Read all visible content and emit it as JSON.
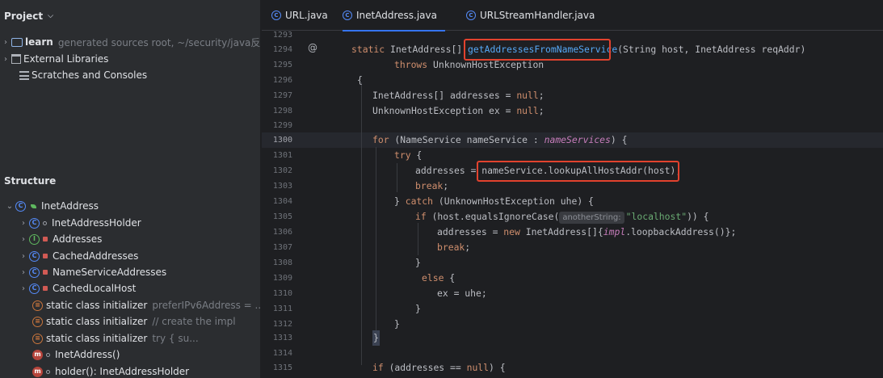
{
  "project": {
    "title": "Project",
    "items": [
      {
        "label": "learn",
        "hint": "generated sources root, ~/security/java反序列化"
      },
      {
        "label": "External Libraries",
        "hint": ""
      },
      {
        "label": "Scratches and Consoles",
        "hint": ""
      }
    ]
  },
  "structure": {
    "title": "Structure",
    "root": "InetAddress",
    "items": [
      {
        "label": "InetAddressHolder",
        "hint": ""
      },
      {
        "label": "Addresses",
        "hint": ""
      },
      {
        "label": "CachedAddresses",
        "hint": ""
      },
      {
        "label": "NameServiceAddresses",
        "hint": ""
      },
      {
        "label": "CachedLocalHost",
        "hint": ""
      },
      {
        "label": "static class initializer",
        "hint": "preferIPv6Address = ..."
      },
      {
        "label": "static class initializer",
        "hint": "// create the impl"
      },
      {
        "label": "static class initializer",
        "hint": "try {          su..."
      },
      {
        "label": "InetAddress()",
        "hint": ""
      },
      {
        "label": "holder(): InetAddressHolder",
        "hint": ""
      }
    ]
  },
  "tabs": [
    {
      "label": "URL.java"
    },
    {
      "label": "InetAddress.java"
    },
    {
      "label": "URLStreamHandler.java"
    }
  ],
  "editor": {
    "line_numbers": [
      "1293",
      "1294",
      "1295",
      "1296",
      "1297",
      "1298",
      "1299",
      "1300",
      "1301",
      "1302",
      "1303",
      "1304",
      "1305",
      "1306",
      "1307",
      "1308",
      "1309",
      "1310",
      "1311",
      "1312",
      "1313",
      "1314",
      "1315"
    ],
    "gutter_marker": "@",
    "code": {
      "l1294_a": "static",
      "l1294_b": " InetAddress[] ",
      "l1294_method": "getAddressesFromNameService",
      "l1294_c": "(String host, InetAddress reqAddr)",
      "l1295_a": "throws",
      "l1295_b": " UnknownHostException",
      "l1296": "{",
      "l1297_a": "InetAddress[] addresses = ",
      "l1297_b": "null",
      "l1297_c": ";",
      "l1298_a": "UnknownHostException ex = ",
      "l1298_b": "null",
      "l1298_c": ";",
      "l1300_a": "for",
      "l1300_b": " (NameService nameService : ",
      "l1300_field": "nameServices",
      "l1300_c": ") {",
      "l1301_a": "try",
      "l1301_b": " {",
      "l1302_a": "addresses = ",
      "l1302_b": "nameService.lookupAllHostAddr(host);",
      "l1303_a": "break",
      "l1303_b": ";",
      "l1304_a": "} ",
      "l1304_b": "catch",
      "l1304_c": " (UnknownHostException uhe) {",
      "l1305_a": "if",
      "l1305_b": " (host.equalsIgnoreCase(",
      "l1305_hint": "anotherString:",
      "l1305_str": "\"localhost\"",
      "l1305_c": ")) {",
      "l1306_a": "addresses = ",
      "l1306_b": "new",
      "l1306_c": " InetAddress[]{",
      "l1306_field": "impl",
      "l1306_d": ".loopbackAddress()};",
      "l1307_a": "break",
      "l1307_b": ";",
      "l1308": "}",
      "l1309_a": "else",
      "l1309_b": " {",
      "l1310": "ex = uhe;",
      "l1311": "}",
      "l1312": "}",
      "l1313": "}",
      "l1315_a": "if",
      "l1315_b": " (addresses == ",
      "l1315_c": "null",
      "l1315_d": ") {"
    }
  },
  "colors": {
    "highlight_box": "#e2422e",
    "accent": "#3574f0"
  }
}
